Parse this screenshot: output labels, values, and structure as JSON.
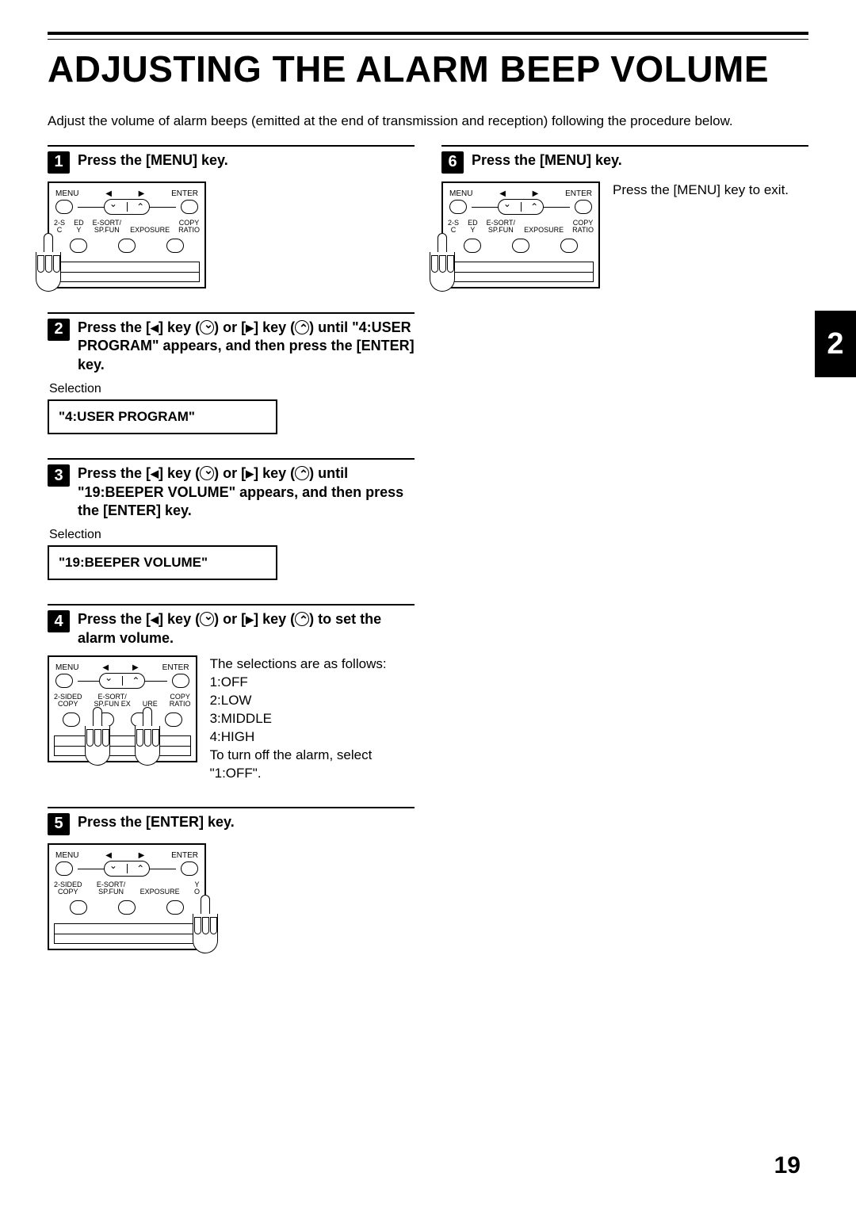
{
  "title": "ADJUSTING THE ALARM BEEP VOLUME",
  "intro": "Adjust the volume of alarm beeps (emitted at the end of transmission and reception) following the procedure below.",
  "side_tab": "2",
  "page_number": "19",
  "panel_labels": {
    "menu": "MENU",
    "enter": "ENTER",
    "two_sided": "2-SIDED",
    "copy_small": "COPY",
    "esort": "E-SORT/",
    "spfun": "SP.FUN",
    "exposure": "EXPOSURE",
    "copy": "COPY",
    "ratio": "RATIO",
    "ed": "ED",
    "y": "Y",
    "ure": "URE"
  },
  "steps": {
    "s1": {
      "num": "1",
      "title": "Press the [MENU] key."
    },
    "s2": {
      "num": "2",
      "title_parts": {
        "a": "Press the [",
        "b": "] key (",
        "c": ") or [",
        "d": "] key (",
        "e": ") until \"4:USER PROGRAM\" appears, and then press the [ENTER] key."
      },
      "selection_label": "Selection",
      "display": "\"4:USER PROGRAM\""
    },
    "s3": {
      "num": "3",
      "title_parts": {
        "a": "Press the [",
        "b": "] key (",
        "c": ") or [",
        "d": "] key (",
        "e": ") until \"19:BEEPER VOLUME\" appears, and then press the [ENTER] key."
      },
      "selection_label": "Selection",
      "display": "\"19:BEEPER VOLUME\""
    },
    "s4": {
      "num": "4",
      "title_parts": {
        "a": "Press the [",
        "b": "] key (",
        "c": ") or [",
        "d": "] key (",
        "e": ") to set the alarm volume."
      },
      "note_l1": "The selections are as follows:",
      "note_l2": "1:OFF",
      "note_l3": "2:LOW",
      "note_l4": "3:MIDDLE",
      "note_l5": "4:HIGH",
      "note_l6": "To turn off the alarm, select \"1:OFF\"."
    },
    "s5": {
      "num": "5",
      "title": "Press the [ENTER] key."
    },
    "s6": {
      "num": "6",
      "title": "Press the [MENU] key.",
      "note": "Press the [MENU] key to exit."
    }
  }
}
